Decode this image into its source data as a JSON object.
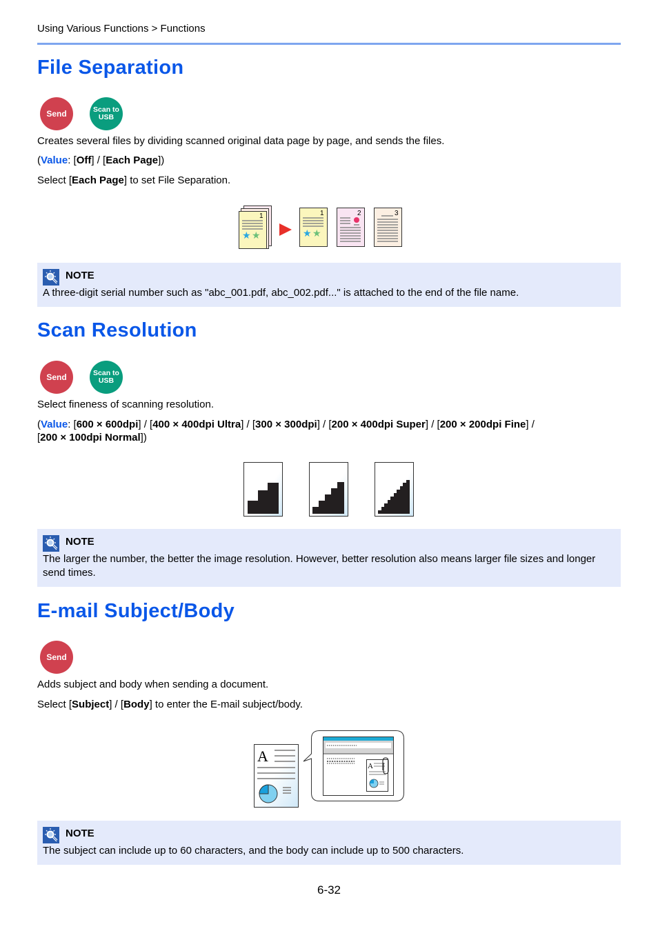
{
  "header": {
    "breadcrumb": "Using Various Functions > Functions",
    "rule_color": "#7ea6ef"
  },
  "colors": {
    "heading": "#0a57e8",
    "send_badge": "#d0414f",
    "usb_badge": "#0a9d7e",
    "note_background": "#e4eafb"
  },
  "sections": [
    {
      "title": "File Separation",
      "badges": [
        {
          "label": "Send",
          "type": "send"
        },
        {
          "label_line1": "Scan to",
          "label_line2": "USB",
          "type": "usb"
        }
      ],
      "description": "Creates several files by dividing scanned original data page by page, and sends the files.",
      "value_line": {
        "open": "(",
        "value_label": "Value",
        "sep": ": [",
        "options": [
          "Off",
          "Each Page"
        ],
        "divider": "] / [",
        "close": "])"
      },
      "instruction": {
        "prefix": "Select [",
        "bold": "Each Page",
        "suffix": "] to set File Separation."
      },
      "illustration": {
        "icon": "file-separation-illustration",
        "pages": [
          "1",
          "2",
          "3"
        ],
        "source_page": "1"
      },
      "note": {
        "title": "NOTE",
        "text": "A three-digit serial number such as \"abc_001.pdf, abc_002.pdf...\" is attached to the end of the file name."
      }
    },
    {
      "title": "Scan Resolution",
      "badges": [
        {
          "label": "Send",
          "type": "send"
        },
        {
          "label_line1": "Scan to",
          "label_line2": "USB",
          "type": "usb"
        }
      ],
      "description": "Select fineness of scanning resolution.",
      "value_line": {
        "open": "(",
        "value_label": "Value",
        "options": [
          "600 × 600dpi",
          "400 × 400dpi Ultra",
          "300 × 300dpi",
          "200 × 400dpi Super",
          "200 × 200dpi Fine",
          "200 × 100dpi Normal"
        ]
      },
      "illustration": {
        "icon": "resolution-staircase-illustration",
        "panels": [
          "low-resolution",
          "medium-resolution",
          "high-resolution"
        ]
      },
      "note": {
        "title": "NOTE",
        "text": "The larger the number, the better the image resolution. However, better resolution also means larger file sizes and longer send times."
      }
    },
    {
      "title": "E-mail Subject/Body",
      "badges": [
        {
          "label": "Send",
          "type": "send"
        }
      ],
      "description": "Adds subject and body when sending a document.",
      "instruction": {
        "prefix": "Select [",
        "bold1": "Subject",
        "mid": "] / [",
        "bold2": "Body",
        "suffix": "] to enter the E-mail subject/body."
      },
      "illustration": {
        "icon": "email-with-attachment-illustration",
        "letter": "A"
      },
      "note": {
        "title": "NOTE",
        "text": "The subject can include up to 60 characters, and the body can include up to 500 characters."
      }
    }
  ],
  "footer": {
    "page_number": "6-32"
  }
}
